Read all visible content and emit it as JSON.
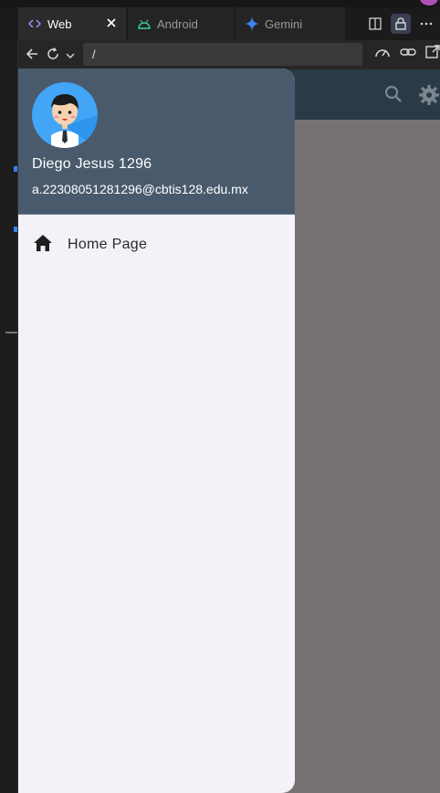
{
  "tabs": [
    {
      "label": "Web",
      "icon": "code-icon",
      "active": true
    },
    {
      "label": "Android",
      "icon": "android-icon"
    },
    {
      "label": "Gemini",
      "icon": "gemini-sparkle-icon"
    }
  ],
  "address_bar": {
    "value": "/"
  },
  "drawer": {
    "user_name": "Diego Jesus 1296",
    "user_email": "a.22308051281296@cbtis128.edu.mx",
    "menu": [
      {
        "label": "Home Page",
        "icon": "home-icon"
      }
    ]
  },
  "colors": {
    "drawer_header": "#4a5a6d",
    "drawer_body": "#f5f1f8",
    "app_bar": "#2a3a47",
    "scrim": "#767274",
    "avatar_bg": "#42a5f5"
  }
}
